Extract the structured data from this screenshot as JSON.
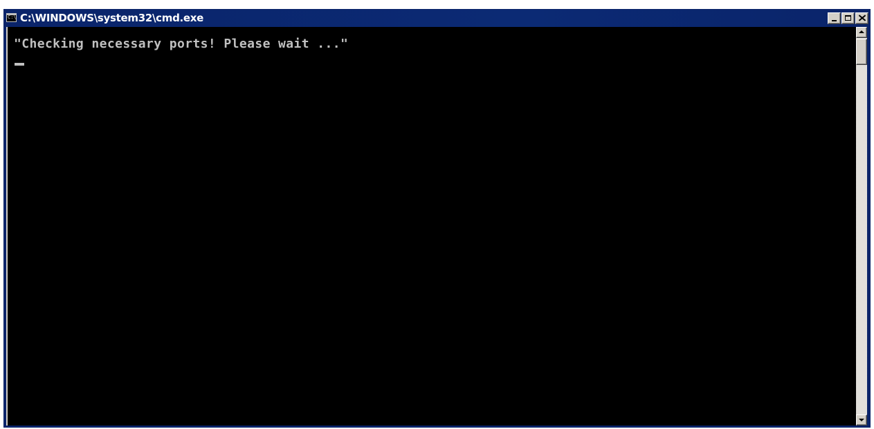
{
  "window": {
    "title": "C:\\WINDOWS\\system32\\cmd.exe",
    "icon": "console-icon",
    "icon_glyph": "C:\\",
    "controls": {
      "minimize_icon": "minimize-icon",
      "maximize_icon": "maximize-icon",
      "close_icon": "close-icon"
    }
  },
  "console": {
    "lines": [
      "\"Checking necessary ports! Please wait ...\""
    ],
    "text_color": "#c0c0c0",
    "background_color": "#000000"
  },
  "scrollbar": {
    "up_icon": "arrow-up-icon",
    "down_icon": "arrow-down-icon"
  },
  "colors": {
    "titlebar": "#0a246a",
    "chrome": "#d4d0c8"
  }
}
